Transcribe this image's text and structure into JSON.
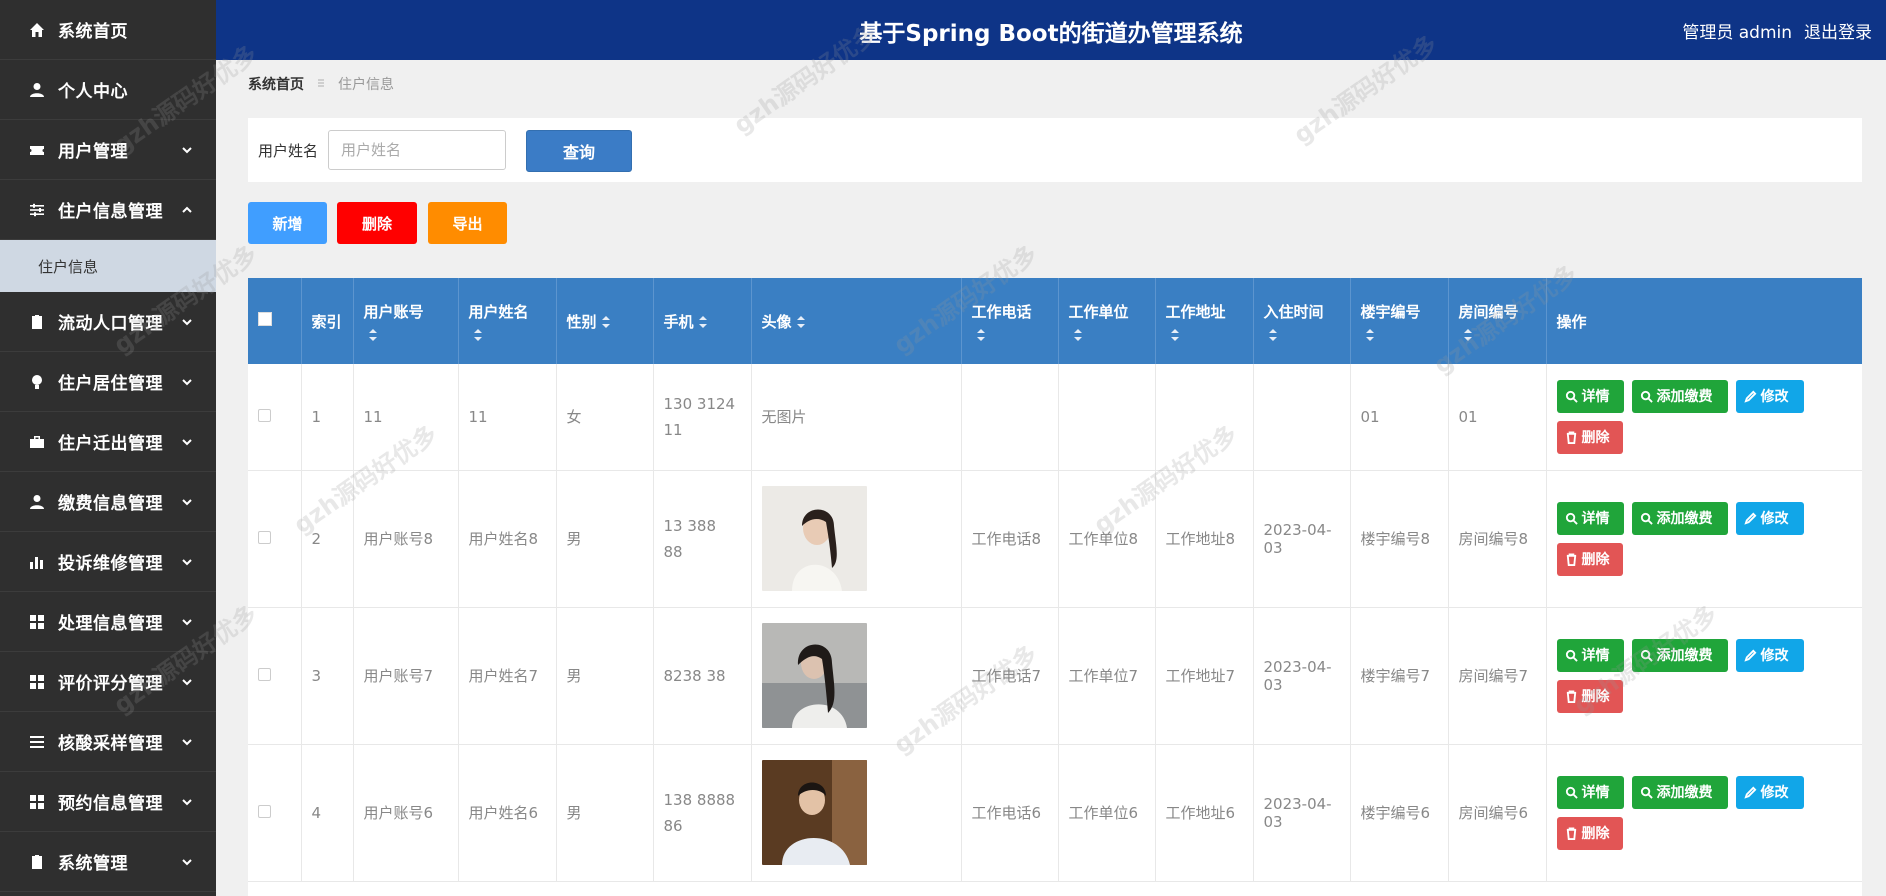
{
  "header": {
    "title": "基于Spring Boot的街道办管理系统",
    "user": "管理员 admin",
    "logout": "退出登录"
  },
  "sidebar": {
    "items": [
      {
        "label": "系统首页",
        "icon": "home-icon"
      },
      {
        "label": "个人中心",
        "icon": "user-icon"
      },
      {
        "label": "用户管理",
        "icon": "ticket-icon"
      },
      {
        "label": "住户信息管理",
        "icon": "sliders-icon"
      },
      {
        "label": "流动人口管理",
        "icon": "clipboard-check-icon"
      },
      {
        "label": "住户居住管理",
        "icon": "lightbulb-icon"
      },
      {
        "label": "住户迁出管理",
        "icon": "briefcase-icon"
      },
      {
        "label": "缴费信息管理",
        "icon": "user-icon"
      },
      {
        "label": "投诉维修管理",
        "icon": "bar-chart-icon"
      },
      {
        "label": "处理信息管理",
        "icon": "grid-icon"
      },
      {
        "label": "评价评分管理",
        "icon": "grid-icon"
      },
      {
        "label": "核酸采样管理",
        "icon": "list-icon"
      },
      {
        "label": "预约信息管理",
        "icon": "grid-icon"
      },
      {
        "label": "系统管理",
        "icon": "clipboard-x-icon"
      }
    ],
    "sub_item": "住户信息"
  },
  "breadcrumb": {
    "home": "系统首页",
    "current": "住户信息"
  },
  "search": {
    "label": "用户姓名",
    "placeholder": "用户姓名",
    "button": "查询"
  },
  "actions": {
    "add": "新增",
    "delete": "删除",
    "export": "导出"
  },
  "table": {
    "headers": [
      "索引",
      "用户账号",
      "用户姓名",
      "性别",
      "手机",
      "头像",
      "工作电话",
      "工作单位",
      "工作地址",
      "入住时间",
      "楼宇编号",
      "房间编号",
      "操作"
    ],
    "rows": [
      {
        "index": "1",
        "account": "11",
        "name": "11",
        "gender": "女",
        "phone1": "130  3124",
        "phone2": "11",
        "avatar": "无图片",
        "work_phone": "",
        "work_unit": "",
        "work_addr": "",
        "checkin": "",
        "building": "01",
        "room": "01"
      },
      {
        "index": "2",
        "account": "用户账号8",
        "name": "用户姓名8",
        "gender": "男",
        "phone1": "13   388",
        "phone2": "88",
        "avatar": "",
        "work_phone": "工作电话8",
        "work_unit": "工作单位8",
        "work_addr": "工作地址8",
        "checkin": "2023-04-03",
        "building": "楼宇编号8",
        "room": "房间编号8"
      },
      {
        "index": "3",
        "account": "用户账号7",
        "name": "用户姓名7",
        "gender": "男",
        "phone1": "  8238  38",
        "phone2": "",
        "avatar": "",
        "work_phone": "工作电话7",
        "work_unit": "工作单位7",
        "work_addr": "工作地址7",
        "checkin": "2023-04-03",
        "building": "楼宇编号7",
        "room": "房间编号7"
      },
      {
        "index": "4",
        "account": "用户账号6",
        "name": "用户姓名6",
        "gender": "男",
        "phone1": "138  8888",
        "phone2": "86",
        "avatar": "",
        "work_phone": "工作电话6",
        "work_unit": "工作单位6",
        "work_addr": "工作地址6",
        "checkin": "2023-04-03",
        "building": "楼宇编号6",
        "room": "房间编号6"
      }
    ],
    "ops": {
      "detail": "详情",
      "pay": "添加缴费",
      "edit": "修改",
      "delete": "删除"
    }
  },
  "watermark": "gzh源码好优多",
  "colors": {
    "header": "#0e3487",
    "sidebar": "#2f2f2f",
    "table_head": "#3a7fc3",
    "green": "#20a53a",
    "blue": "#11a6e8",
    "red": "#e25555"
  }
}
